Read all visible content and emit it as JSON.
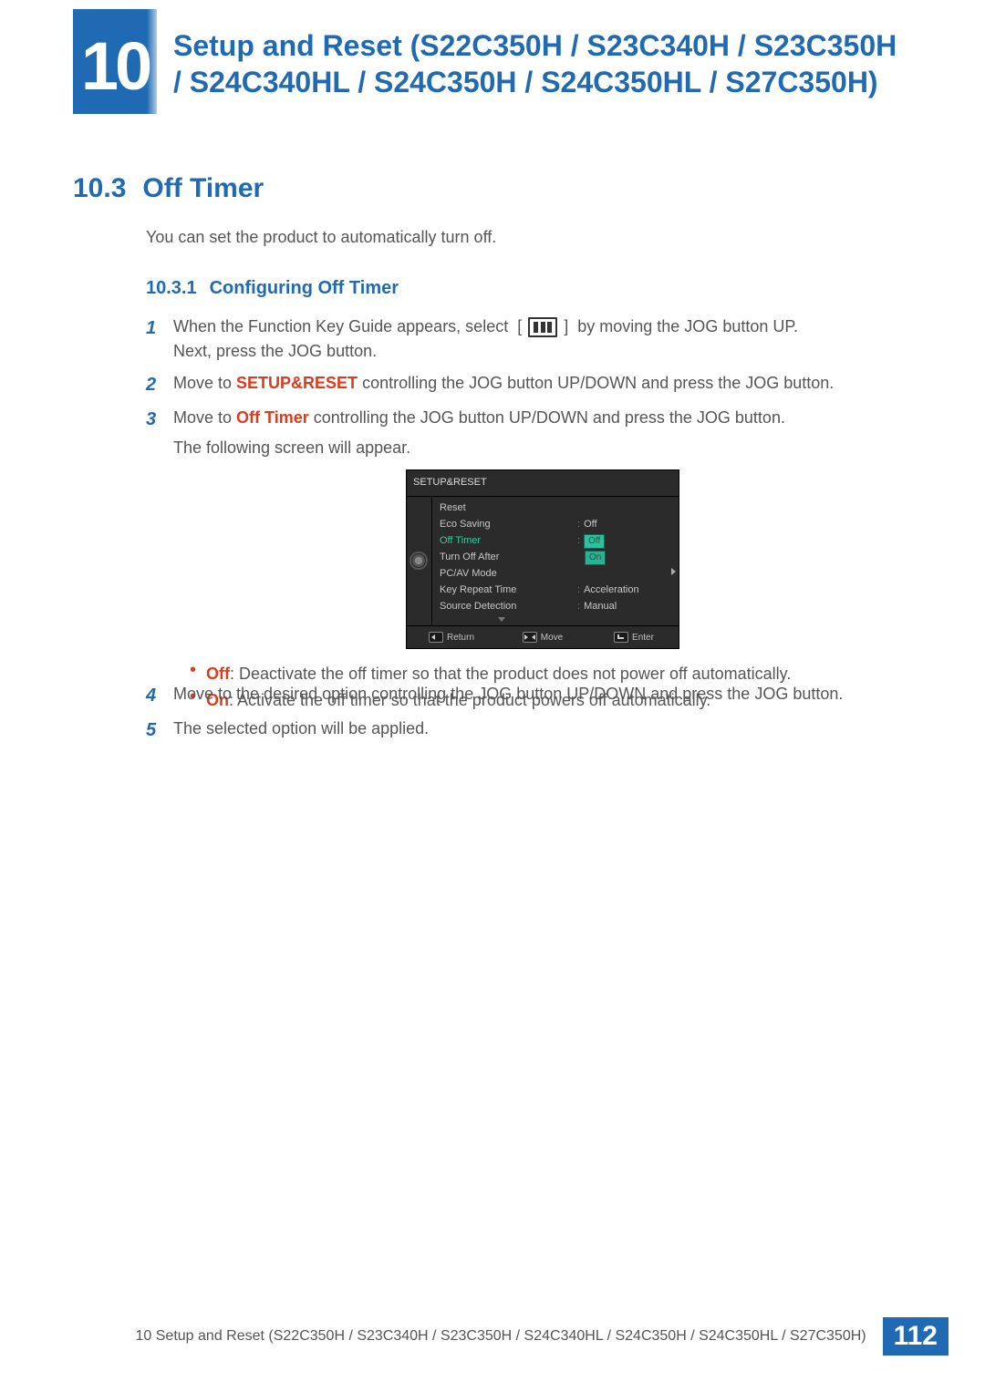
{
  "chapter": {
    "number": "10",
    "title": "Setup and Reset (S22C350H / S23C340H / S23C350H / S24C340HL / S24C350H / S24C350HL / S27C350H)"
  },
  "section": {
    "num": "10.3",
    "title": "Off Timer"
  },
  "intro": "You can set the product to automatically turn off.",
  "subsection": {
    "num": "10.3.1",
    "title": "Configuring Off Timer"
  },
  "steps": {
    "s1a": "When the Function Key Guide appears, select",
    "s1b": "by moving the JOG button UP.",
    "s1c": "Next, press the JOG button.",
    "s2a": "Move to ",
    "s2b": "SETUP&RESET",
    "s2c": " controlling the JOG button UP/DOWN and press the JOG button.",
    "s3a": "Move to ",
    "s3b": "Off Timer",
    "s3c": " controlling the JOG button UP/DOWN and press the JOG button.",
    "s3d": "The following screen will appear.",
    "off_label": "Off",
    "off_desc": ": Deactivate the off timer so that the product does not power off automatically.",
    "on_label": "On",
    "on_desc": ": Activate the off timer so that the product powers off automatically.",
    "s4": "Move to the desired option controlling the JOG button UP/DOWN and press the JOG button.",
    "s5": "The selected option will be applied."
  },
  "osd": {
    "title": "SETUP&RESET",
    "items": [
      "Reset",
      "Eco Saving",
      "Off Timer",
      "Turn Off After",
      "PC/AV Mode",
      "Key Repeat Time",
      "Source Detection"
    ],
    "values": {
      "eco": "Off",
      "off_timer_options": [
        "Off",
        "On"
      ],
      "key_repeat": "Acceleration",
      "source": "Manual"
    },
    "footer": {
      "return": "Return",
      "move": "Move",
      "enter": "Enter"
    }
  },
  "footer": {
    "breadcrumb": "10 Setup and Reset (S22C350H / S23C340H / S23C350H / S24C340HL / S24C350H / S24C350HL / S27C350H)",
    "page": "112"
  }
}
